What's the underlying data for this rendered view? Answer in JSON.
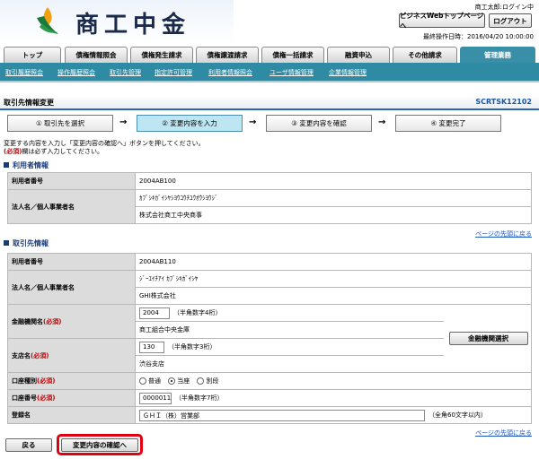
{
  "header": {
    "brand": "商工中金",
    "user_status": "商工太郎:ログイン中",
    "biz_top_button": "ビジネスWebトップページへ",
    "logout_button": "ログアウト",
    "last_operation": "最終操作日時：2016/04/20 10:00:00"
  },
  "tabs": [
    "トップ",
    "債権情報照会",
    "債権発生請求",
    "債権譲渡請求",
    "債権一括請求",
    "融資申込",
    "その他請求",
    "管理業務"
  ],
  "subnav": [
    "取引履歴照会",
    "操作履歴照会",
    "取引先管理",
    "指定許可管理",
    "利用者情報照会",
    "ユーザ情報管理",
    "企業情報管理"
  ],
  "page": {
    "title": "取引先情報変更",
    "screen_code": "SCRTSK12102"
  },
  "steps": [
    "① 取引先を選択",
    "② 変更内容を入力",
    "③ 変更内容を確認",
    "④ 変更完了"
  ],
  "instructions": {
    "line1": "変更する内容を入力し「変更内容の確認へ」ボタンを押してください。",
    "required_tag": "(必須)",
    "line2": "欄は必ず入力してください。"
  },
  "user_info": {
    "heading": "利用者情報",
    "user_number_label": "利用者番号",
    "user_number": "2004AB100",
    "name_label": "法人名／個人事業者名",
    "name_kana": "ｶﾌﾞｼｷｶﾞｲｼﾔｼﾖｳｺｳﾁﾕｳｵｳｼﾖｳｼﾞ",
    "name": "株式会社商工中央商事"
  },
  "partner_info": {
    "heading": "取引先情報",
    "user_number_label": "利用者番号",
    "user_number": "2004AB110",
    "name_label": "法人名／個人事業者名",
    "name_kana": "ｼﾞｰｴｲﾁｱｲ ｶﾌﾞｼｷｶﾞｲｼﾔ",
    "name": "GHI株式会社",
    "bank_label": "金融機関名",
    "bank_code": "2004",
    "bank_code_note": "（半角数字4桁）",
    "bank_name": "商工組合中央金庫",
    "branch_label": "支店名",
    "branch_code": "130",
    "branch_code_note": "（半角数字3桁）",
    "branch_name": "渋谷支店",
    "bank_select_button": "金融機関選択",
    "account_type_label": "口座種別",
    "account_types": [
      "普通",
      "当座",
      "別段"
    ],
    "account_number_label": "口座番号",
    "account_number": "0000011",
    "account_number_note": "（半角数字7桁）",
    "registered_name_label": "登録名",
    "registered_name": "ＧＨＩ（株）営業部",
    "registered_name_note": "（全角60文字以内）"
  },
  "required_tag": "(必須)",
  "page_top_link": "ページの先頭に戻る",
  "buttons": {
    "back": "戻る",
    "confirm": "変更内容の確認へ"
  },
  "colors": {
    "accent": "#2f8aa3",
    "required": "#c00000",
    "highlight": "#e00010"
  }
}
